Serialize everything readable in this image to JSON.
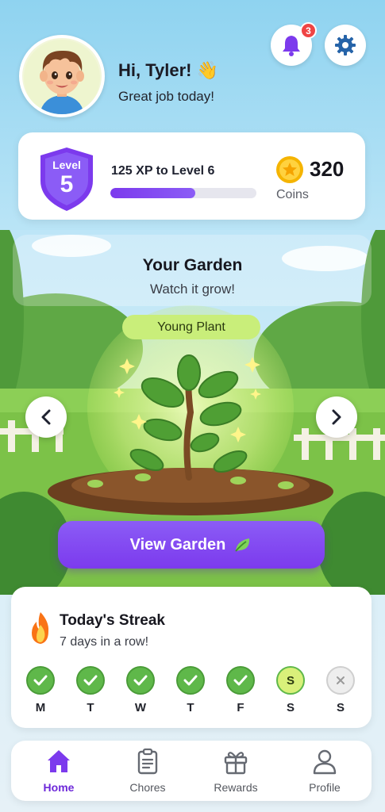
{
  "header": {
    "greeting": "Hi, Tyler! 👋",
    "subtitle": "Great job today!",
    "notification_count": "3",
    "avatar_icon": "boy-avatar-icon",
    "bell_icon": "bell-icon",
    "settings_icon": "gear-icon"
  },
  "level_card": {
    "level_label": "Level",
    "level_number": "5",
    "xp_text": "125 XP to Level 6",
    "xp_progress_percent": 58,
    "coins_value": "320",
    "coins_label": "Coins"
  },
  "garden": {
    "title": "Your Garden",
    "subtitle": "Watch it grow!",
    "stage": "Young Plant",
    "button_label": "View Garden",
    "button_icon": "leaf-icon"
  },
  "streak": {
    "title": "Today's Streak",
    "subtitle": "7 days in a row!",
    "days": [
      {
        "label": "M",
        "status": "done"
      },
      {
        "label": "T",
        "status": "done"
      },
      {
        "label": "W",
        "status": "done"
      },
      {
        "label": "T",
        "status": "done"
      },
      {
        "label": "F",
        "status": "done"
      },
      {
        "label": "S",
        "status": "today",
        "mark": "S"
      },
      {
        "label": "S",
        "status": "missed"
      }
    ]
  },
  "nav": {
    "items": [
      {
        "label": "Home",
        "icon": "home-icon",
        "active": true
      },
      {
        "label": "Chores",
        "icon": "clipboard-icon",
        "active": false
      },
      {
        "label": "Rewards",
        "icon": "gift-icon",
        "active": false
      },
      {
        "label": "Profile",
        "icon": "person-icon",
        "active": false
      }
    ]
  },
  "colors": {
    "accent": "#7c3aed",
    "success": "#5fb84a",
    "stage_pill": "#c9ee7a",
    "badge": "#ef4444"
  }
}
